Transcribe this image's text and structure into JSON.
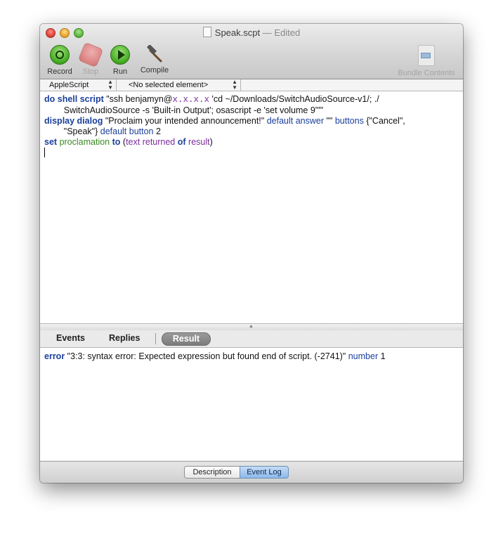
{
  "window": {
    "title": "Speak.scpt",
    "title_status": " — Edited"
  },
  "toolbar": {
    "record_label": "Record",
    "stop_label": "Stop",
    "run_label": "Run",
    "compile_label": "Compile",
    "bundle_label": "Bundle Contents"
  },
  "selectors": {
    "language": "AppleScript",
    "element": "<No selected element>"
  },
  "script": {
    "line1": {
      "kw": "do shell script",
      "str1": " \"ssh benjamyn@",
      "host": "x.x.x.x",
      "str2": " 'cd ~/Downloads/SwitchAudioSource-v1/; ./"
    },
    "line2": "        SwitchAudioSource -s 'Built-in Output'; osascript -e 'set volume 9'\"\"",
    "line3": {
      "kw": "display dialog",
      "str": " \"Proclaim your intended announcement!\" ",
      "p1": "default answer",
      "s2": " \"\" ",
      "p2": "buttons",
      "s3": " {\"Cancel\","
    },
    "line4": {
      "s1": "        \"Speak\"} ",
      "p1": "default button",
      "s2": " 2"
    },
    "line5": {
      "kw1": "set",
      "var": "proclamation",
      "kw2": "to",
      "paren1": " (",
      "prop1": "text returned",
      "kw3": "of",
      "prop2": "result",
      "paren2": ")"
    }
  },
  "tabs": {
    "events": "Events",
    "replies": "Replies",
    "result": "Result"
  },
  "result": {
    "kw": "error",
    "message": " \"3:3: syntax error: Expected expression but found end of script. (-2741)\" ",
    "num_kw": "number",
    "num_val": " 1"
  },
  "bottom": {
    "description": "Description",
    "event_log": "Event Log"
  }
}
